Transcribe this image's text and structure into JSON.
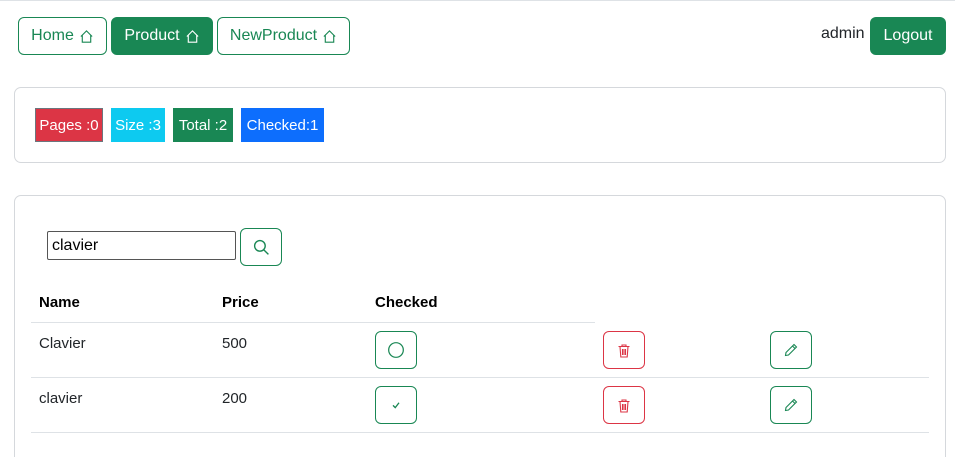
{
  "nav": {
    "home_label": "Home",
    "product_label": "Product",
    "newproduct_label": "NewProduct",
    "active": "Product"
  },
  "user": {
    "username": "admin",
    "logout_label": "Logout"
  },
  "stats": {
    "pages": "Pages :0",
    "size": "Size :3",
    "total": "Total :2",
    "checked": "Checked:1"
  },
  "search": {
    "value": "clavier",
    "icon": "search-icon"
  },
  "table": {
    "headers": [
      "Name",
      "Price",
      "Checked"
    ],
    "rows": [
      {
        "name": "Clavier",
        "price": "500",
        "checked": false
      },
      {
        "name": "clavier",
        "price": "200",
        "checked": true
      }
    ]
  },
  "colors": {
    "success": "#198754",
    "danger": "#dc3545",
    "info": "#0dcaf0",
    "primary": "#0d6efd"
  }
}
